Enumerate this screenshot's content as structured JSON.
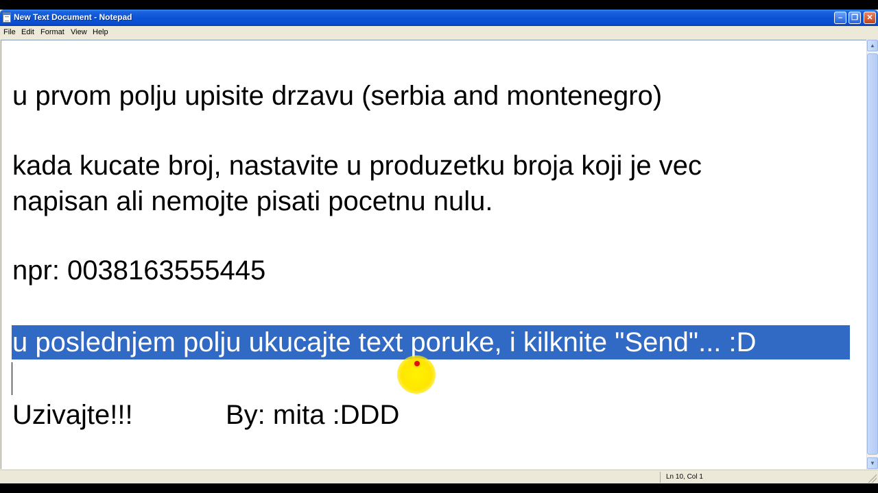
{
  "window": {
    "title": "New Text Document - Notepad",
    "buttons": {
      "minimize": "–",
      "maximize": "❐",
      "close": "✕"
    }
  },
  "menu": {
    "items": [
      {
        "label": "File"
      },
      {
        "label": "Edit"
      },
      {
        "label": "Format"
      },
      {
        "label": "View"
      },
      {
        "label": "Help"
      }
    ]
  },
  "editor": {
    "lines": [
      "u prvom polju upisite drzavu (serbia and montenegro)",
      "kada kucate broj, nastavite u produzetku broja koji je vec",
      "napisan ali nemojte pisati pocetnu nulu.",
      "npr: 0038163555445",
      "u poslednjem polju ukucajte text poruke, i kilknite \"Send\"... :D"
    ],
    "last_line_left": "Uzivajte!!!",
    "last_line_right": "By: mita :DDD",
    "selected_line_index": 4
  },
  "status": {
    "position": "Ln 10, Col 1"
  },
  "colors": {
    "selection": "#316ac5",
    "titlebar": "#0a53d5",
    "cursor_highlight": "#ffe600"
  },
  "icons": {
    "app": "notepad-icon",
    "scroll_up": "arrow-up-icon",
    "scroll_down": "arrow-down-icon"
  }
}
